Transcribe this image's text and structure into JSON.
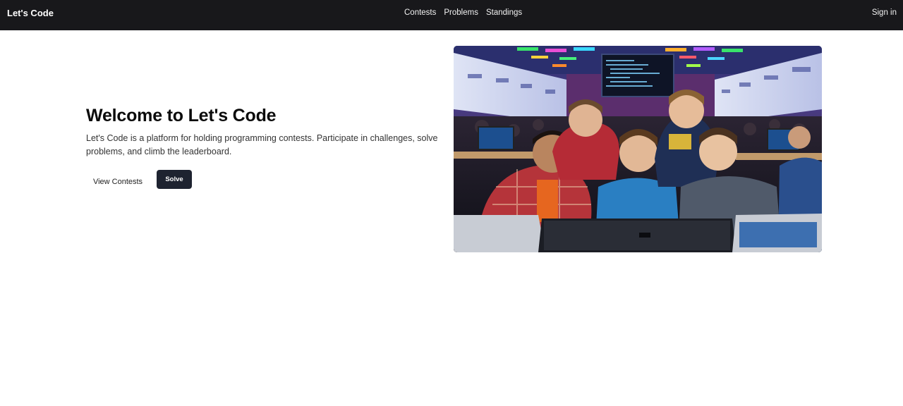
{
  "navbar": {
    "brand": "Let's Code",
    "links": [
      {
        "label": "Contests"
      },
      {
        "label": "Problems"
      },
      {
        "label": "Standings"
      }
    ],
    "signin": "Sign in"
  },
  "hero": {
    "title": "Welcome to Let's Code",
    "description": "Let's Code is a platform for holding programming contests. Participate in challenges, solve problems, and climb the leaderboard.",
    "buttons": {
      "view_contests": "View Contests",
      "solve": "Solve"
    },
    "image_alt": "Programmers gathered around a laptop at a coding contest"
  },
  "colors": {
    "navbar_bg": "#18181b",
    "solve_button_bg": "#1e2330",
    "page_bg": "#ffffff"
  }
}
